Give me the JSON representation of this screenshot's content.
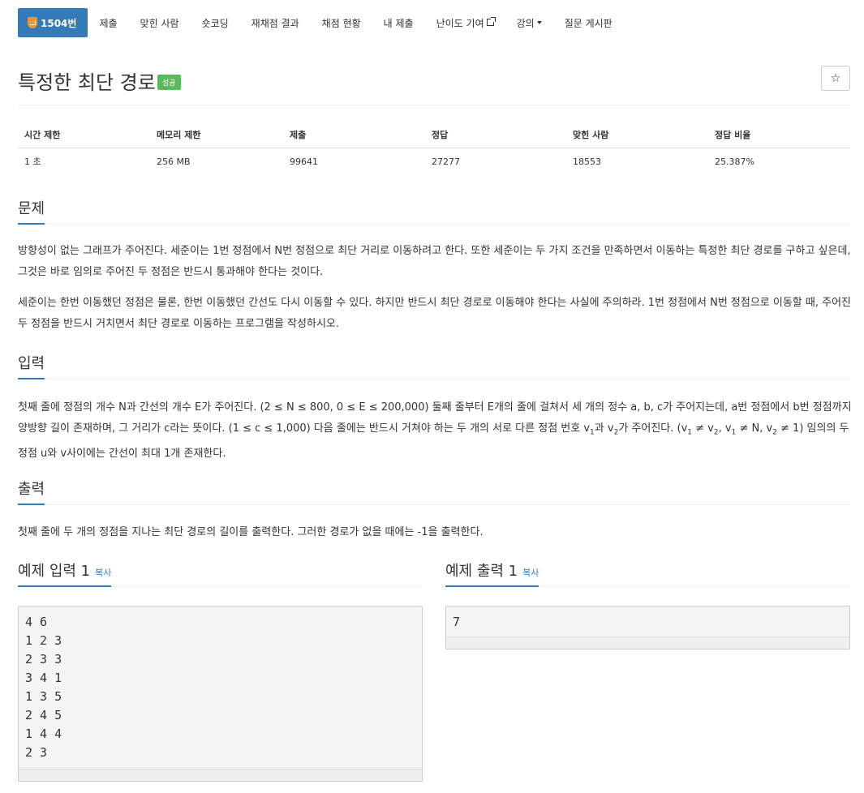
{
  "nav": {
    "problem_id": "1504번",
    "items": [
      "제출",
      "맞힌 사람",
      "숏코딩",
      "재채점 결과",
      "채점 현황",
      "내 제출"
    ],
    "difficulty": "난이도 기여",
    "lecture": "강의",
    "board": "질문 게시판"
  },
  "problem": {
    "title": "특정한 최단 경로",
    "badge": "성공",
    "star": "☆"
  },
  "stats": {
    "headers": [
      "시간 제한",
      "메모리 제한",
      "제출",
      "정답",
      "맞힌 사람",
      "정답 비율"
    ],
    "values": [
      "1 초",
      "256 MB",
      "99641",
      "27277",
      "18553",
      "25.387%"
    ]
  },
  "sections": {
    "problem_heading": "문제",
    "problem_p1": "방향성이 없는 그래프가 주어진다. 세준이는 1번 정점에서 N번 정점으로 최단 거리로 이동하려고 한다. 또한 세준이는 두 가지 조건을 만족하면서 이동하는 특정한 최단 경로를 구하고 싶은데, 그것은 바로 임의로 주어진 두 정점은 반드시 통과해야 한다는 것이다.",
    "problem_p2": "세준이는 한번 이동했던 정점은 물론, 한번 이동했던 간선도 다시 이동할 수 있다. 하지만 반드시 최단 경로로 이동해야 한다는 사실에 주의하라. 1번 정점에서 N번 정점으로 이동할 때, 주어진 두 정점을 반드시 거치면서 최단 경로로 이동하는 프로그램을 작성하시오.",
    "input_heading": "입력",
    "input_part1": "첫째 줄에 정점의 개수 N과 간선의 개수 E가 주어진다. (2 ≤ N ≤ 800, 0 ≤ E ≤ 200,000) 둘째 줄부터 E개의 줄에 걸쳐서 세 개의 정수 a, b, c가 주어지는데, a번 정점에서 b번 정점까지 양방향 길이 존재하며, 그 거리가 c라는 뜻이다. (1 ≤ c ≤ 1,000) 다음 줄에는 반드시 거쳐야 하는 두 개의 서로 다른 정점 번호 v",
    "input_part2": "과 v",
    "input_part3": "가 주어진다. (v",
    "input_part4": " ≠ v",
    "input_part5": ", v",
    "input_part6": " ≠ N, v",
    "input_part7": " ≠ 1) 임의의 두 정점 u와 v사이에는 간선이 최대 1개 존재한다.",
    "sub1": "1",
    "sub2": "2",
    "output_heading": "출력",
    "output_p": "첫째 줄에 두 개의 정점을 지나는 최단 경로의 길이를 출력한다. 그러한 경로가 없을 때에는 -1을 출력한다."
  },
  "samples": {
    "input_label": "예제 입력 1",
    "output_label": "예제 출력 1",
    "copy_label": "복사",
    "input_text": "4 6\n1 2 3\n2 3 3\n3 4 1\n1 3 5\n2 4 5\n1 4 4\n2 3",
    "output_text": "7"
  }
}
